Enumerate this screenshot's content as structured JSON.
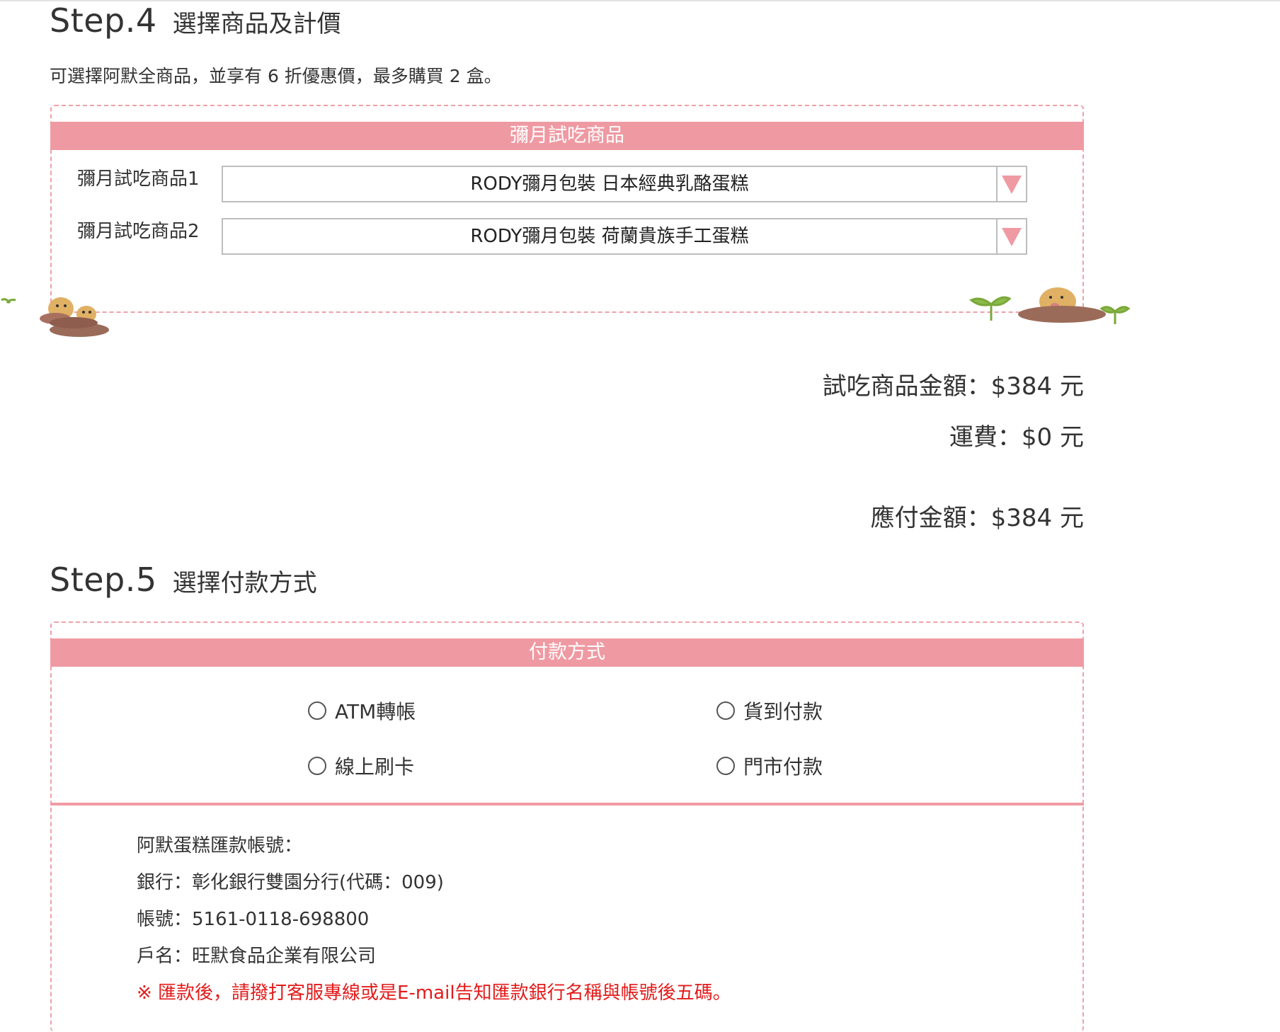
{
  "step4": {
    "num": "Step.4",
    "title": "選擇商品及計價",
    "intro": "可選擇阿默全商品，並享有 6 折優惠價，最多購買 2 盒。",
    "panel_title": "彌月試吃商品",
    "items": [
      {
        "label": "彌月試吃商品1",
        "value": "RODY彌月包裝 日本經典乳酪蛋糕"
      },
      {
        "label": "彌月試吃商品2",
        "value": "RODY彌月包裝 荷蘭貴族手工蛋糕"
      }
    ]
  },
  "summary": {
    "trial_amount": "試吃商品金額：$384 元",
    "shipping": "運費：$0 元",
    "total": "應付金額：$384 元"
  },
  "step5": {
    "num": "Step.5",
    "title": "選擇付款方式",
    "panel_title": "付款方式",
    "options": [
      "ATM轉帳",
      "貨到付款",
      "線上刷卡",
      "門市付款"
    ],
    "bank": {
      "heading": "阿默蛋糕匯款帳號：",
      "bank_name": "銀行：彰化銀行雙園分行(代碼：009)",
      "account": "帳號：5161-0118-698800",
      "holder": "戶名：旺默食品企業有限公司",
      "note": "※ 匯款後，請撥打客服專線或是E-mail告知匯款銀行名稱與帳號後五碼。"
    }
  },
  "colors": {
    "accent_pink": "#ef9aa3",
    "dashed_border": "#f0a0a8",
    "note_red": "#e31b1b"
  }
}
